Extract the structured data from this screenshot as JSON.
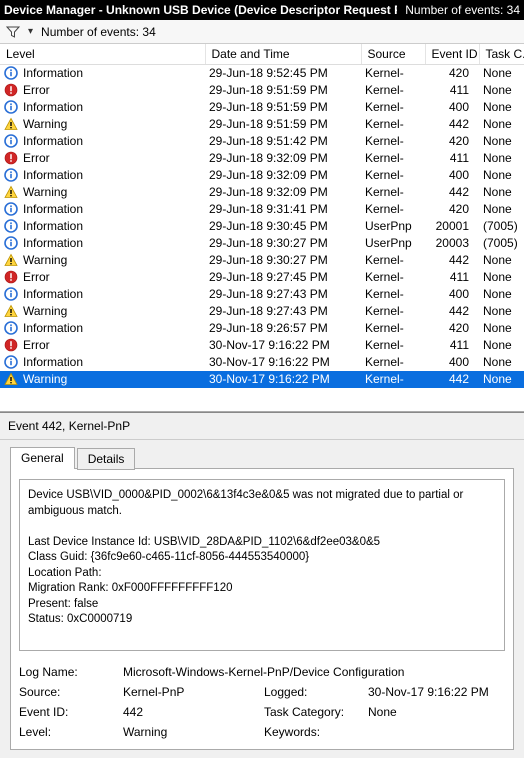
{
  "titlebar": {
    "title": "Device Manager - Unknown USB Device (Device Descriptor Request Failed)",
    "count_label": "Number of events: 34"
  },
  "toolbar": {
    "count_label": "Number of events: 34"
  },
  "columns": {
    "level": "Level",
    "datetime": "Date and Time",
    "source": "Source",
    "eventid": "Event ID",
    "taskc": "Task C..."
  },
  "icons": {
    "info": "info",
    "error": "error",
    "warning": "warning"
  },
  "rows": [
    {
      "icon": "info",
      "level": "Information",
      "dt": "29-Jun-18 9:52:45 PM",
      "src": "Kernel-",
      "eid": "420",
      "task": "None"
    },
    {
      "icon": "error",
      "level": "Error",
      "dt": "29-Jun-18 9:51:59 PM",
      "src": "Kernel-",
      "eid": "411",
      "task": "None"
    },
    {
      "icon": "info",
      "level": "Information",
      "dt": "29-Jun-18 9:51:59 PM",
      "src": "Kernel-",
      "eid": "400",
      "task": "None"
    },
    {
      "icon": "warning",
      "level": "Warning",
      "dt": "29-Jun-18 9:51:59 PM",
      "src": "Kernel-",
      "eid": "442",
      "task": "None"
    },
    {
      "icon": "info",
      "level": "Information",
      "dt": "29-Jun-18 9:51:42 PM",
      "src": "Kernel-",
      "eid": "420",
      "task": "None"
    },
    {
      "icon": "error",
      "level": "Error",
      "dt": "29-Jun-18 9:32:09 PM",
      "src": "Kernel-",
      "eid": "411",
      "task": "None"
    },
    {
      "icon": "info",
      "level": "Information",
      "dt": "29-Jun-18 9:32:09 PM",
      "src": "Kernel-",
      "eid": "400",
      "task": "None"
    },
    {
      "icon": "warning",
      "level": "Warning",
      "dt": "29-Jun-18 9:32:09 PM",
      "src": "Kernel-",
      "eid": "442",
      "task": "None"
    },
    {
      "icon": "info",
      "level": "Information",
      "dt": "29-Jun-18 9:31:41 PM",
      "src": "Kernel-",
      "eid": "420",
      "task": "None"
    },
    {
      "icon": "info",
      "level": "Information",
      "dt": "29-Jun-18 9:30:45 PM",
      "src": "UserPnp",
      "eid": "20001",
      "task": "(7005)"
    },
    {
      "icon": "info",
      "level": "Information",
      "dt": "29-Jun-18 9:30:27 PM",
      "src": "UserPnp",
      "eid": "20003",
      "task": "(7005)"
    },
    {
      "icon": "warning",
      "level": "Warning",
      "dt": "29-Jun-18 9:30:27 PM",
      "src": "Kernel-",
      "eid": "442",
      "task": "None"
    },
    {
      "icon": "error",
      "level": "Error",
      "dt": "29-Jun-18 9:27:45 PM",
      "src": "Kernel-",
      "eid": "411",
      "task": "None"
    },
    {
      "icon": "info",
      "level": "Information",
      "dt": "29-Jun-18 9:27:43 PM",
      "src": "Kernel-",
      "eid": "400",
      "task": "None"
    },
    {
      "icon": "warning",
      "level": "Warning",
      "dt": "29-Jun-18 9:27:43 PM",
      "src": "Kernel-",
      "eid": "442",
      "task": "None"
    },
    {
      "icon": "info",
      "level": "Information",
      "dt": "29-Jun-18 9:26:57 PM",
      "src": "Kernel-",
      "eid": "420",
      "task": "None"
    },
    {
      "icon": "error",
      "level": "Error",
      "dt": "30-Nov-17 9:16:22 PM",
      "src": "Kernel-",
      "eid": "411",
      "task": "None"
    },
    {
      "icon": "info",
      "level": "Information",
      "dt": "30-Nov-17 9:16:22 PM",
      "src": "Kernel-",
      "eid": "400",
      "task": "None"
    },
    {
      "icon": "warning",
      "level": "Warning",
      "dt": "30-Nov-17 9:16:22 PM",
      "src": "Kernel-",
      "eid": "442",
      "task": "None",
      "selected": true
    }
  ],
  "detail": {
    "header": "Event 442, Kernel-PnP",
    "tabs": {
      "general": "General",
      "details": "Details"
    },
    "description": "Device USB\\VID_0000&PID_0002\\6&13f4c3e&0&5 was not migrated due to partial or ambiguous match.\n\nLast Device Instance Id: USB\\VID_28DA&PID_1102\\6&df2ee03&0&5\nClass Guid: {36fc9e60-c465-11cf-8056-444553540000}\nLocation Path:\nMigration Rank: 0xF000FFFFFFFFF120\nPresent: false\nStatus: 0xC0000719",
    "kv": {
      "logname_k": "Log Name:",
      "logname_v": "Microsoft-Windows-Kernel-PnP/Device Configuration",
      "source_k": "Source:",
      "source_v": "Kernel-PnP",
      "logged_k": "Logged:",
      "logged_v": "30-Nov-17 9:16:22 PM",
      "eventid_k": "Event ID:",
      "eventid_v": "442",
      "taskcat_k": "Task Category:",
      "taskcat_v": "None",
      "level_k": "Level:",
      "level_v": "Warning",
      "keywords_k": "Keywords:",
      "keywords_v": ""
    }
  }
}
